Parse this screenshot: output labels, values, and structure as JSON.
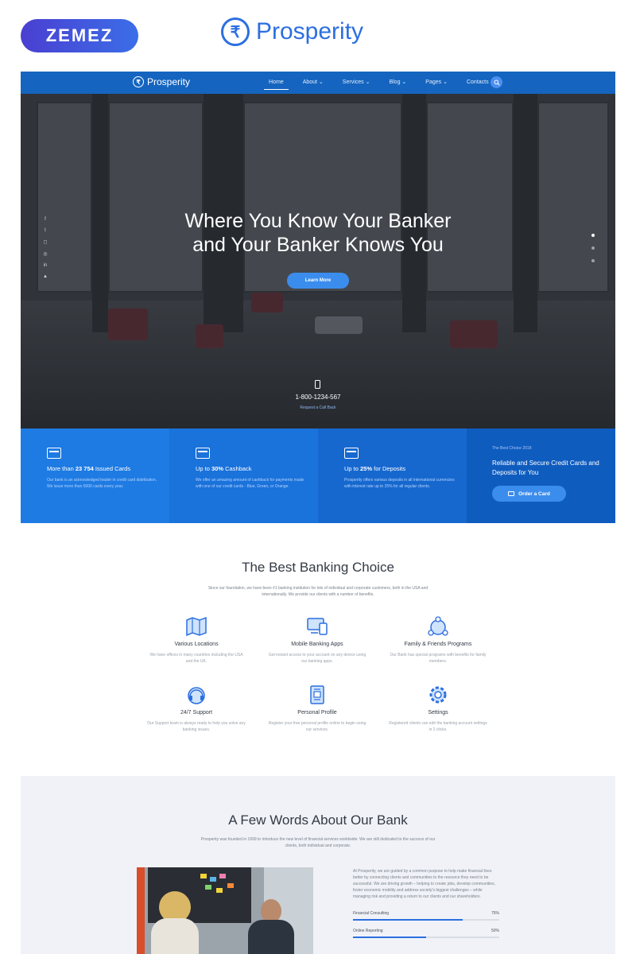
{
  "top": {
    "zemez": "ZEMEZ",
    "brand": "Prosperity"
  },
  "nav": {
    "logo": "Prosperity",
    "items": [
      "Home",
      "About ⌄",
      "Services ⌄",
      "Blog ⌄",
      "Pages ⌄",
      "Contacts"
    ]
  },
  "hero": {
    "title_line1": "Where You Know Your Banker",
    "title_line2": "and Your Banker Knows You",
    "button": "Learn More",
    "phone": "1-800-1234-567",
    "callback": "Request a Call Back",
    "social_icons": [
      "facebook-icon",
      "twitter-icon",
      "instagram-icon",
      "messenger-icon",
      "linkedin-icon",
      "snapchat-icon"
    ]
  },
  "features": [
    {
      "title_pre": "More than ",
      "title_bold": "23 754",
      "title_post": " Issued Cards",
      "text": "Our bank is an acknowledged leader in credit card distribution. We issue more than 5000 cards every year.",
      "bg": "#1e7be3"
    },
    {
      "title_pre": "Up to ",
      "title_bold": "30%",
      "title_post": " Cashback",
      "text": "We offer an amazing amount of cashback for payments made with one of our credit cards - Blue, Green, or Orange.",
      "bg": "#1a72db"
    },
    {
      "title_pre": "Up to ",
      "title_bold": "25%",
      "title_post": " for Deposits",
      "text": "Prosperity offers various deposits in all international currencies with interest rate up to 25% for all regular clients.",
      "bg": "#1668cf"
    }
  ],
  "card_offer": {
    "small": "The Best Choice 2018",
    "headline": "Reliable and Secure Credit Cards and Deposits for You",
    "button": "Order a Card",
    "bg": "#0f5cbf"
  },
  "best": {
    "title": "The Best Banking Choice",
    "subtitle": "Since our foundation, we have been #1 banking institution for lots of individual and corporate customers, both in the USA and internationally. We provide our clients with a number of benefits.",
    "items": [
      {
        "title": "Various Locations",
        "text": "We have offices in many countries including the USA and the UK."
      },
      {
        "title": "Mobile Banking Apps",
        "text": "Get instant access to your account on any device using our banking apps."
      },
      {
        "title": "Family & Friends Programs",
        "text": "Our Bank has special programs with benefits for family members."
      },
      {
        "title": "24/7 Support",
        "text": "Our Support team is always ready to help you solve any banking issues."
      },
      {
        "title": "Personal Profile",
        "text": "Register your free personal profile online to begin using our services."
      },
      {
        "title": "Settings",
        "text": "Registered clients can edit the banking account settings in 2 clicks."
      }
    ]
  },
  "about": {
    "title": "A Few Words About Our Bank",
    "subtitle": "Prosperity was founded in 1999 to introduce the new level of financial services worldwide. We are still dedicated to the success of our clients, both individual and corporate.",
    "text": "At Prosperity, we are guided by a common purpose to help make financial lives better by connecting clients and communities to the resource they need to be successful. We are driving growth – helping to create jobs, develop communities, foster economic mobility and address society's biggest challenges – while managing risk and providing a return to our clients and our shareholders.",
    "bars": [
      {
        "label": "Financial Consulting",
        "value": "75%",
        "fraction": 0.75
      },
      {
        "label": "Online Reporting",
        "value": "50%",
        "fraction": 0.5
      }
    ]
  },
  "colors": {
    "accent": "#2c6fe0",
    "nav": "#1565c0",
    "button": "#3b8ded"
  }
}
